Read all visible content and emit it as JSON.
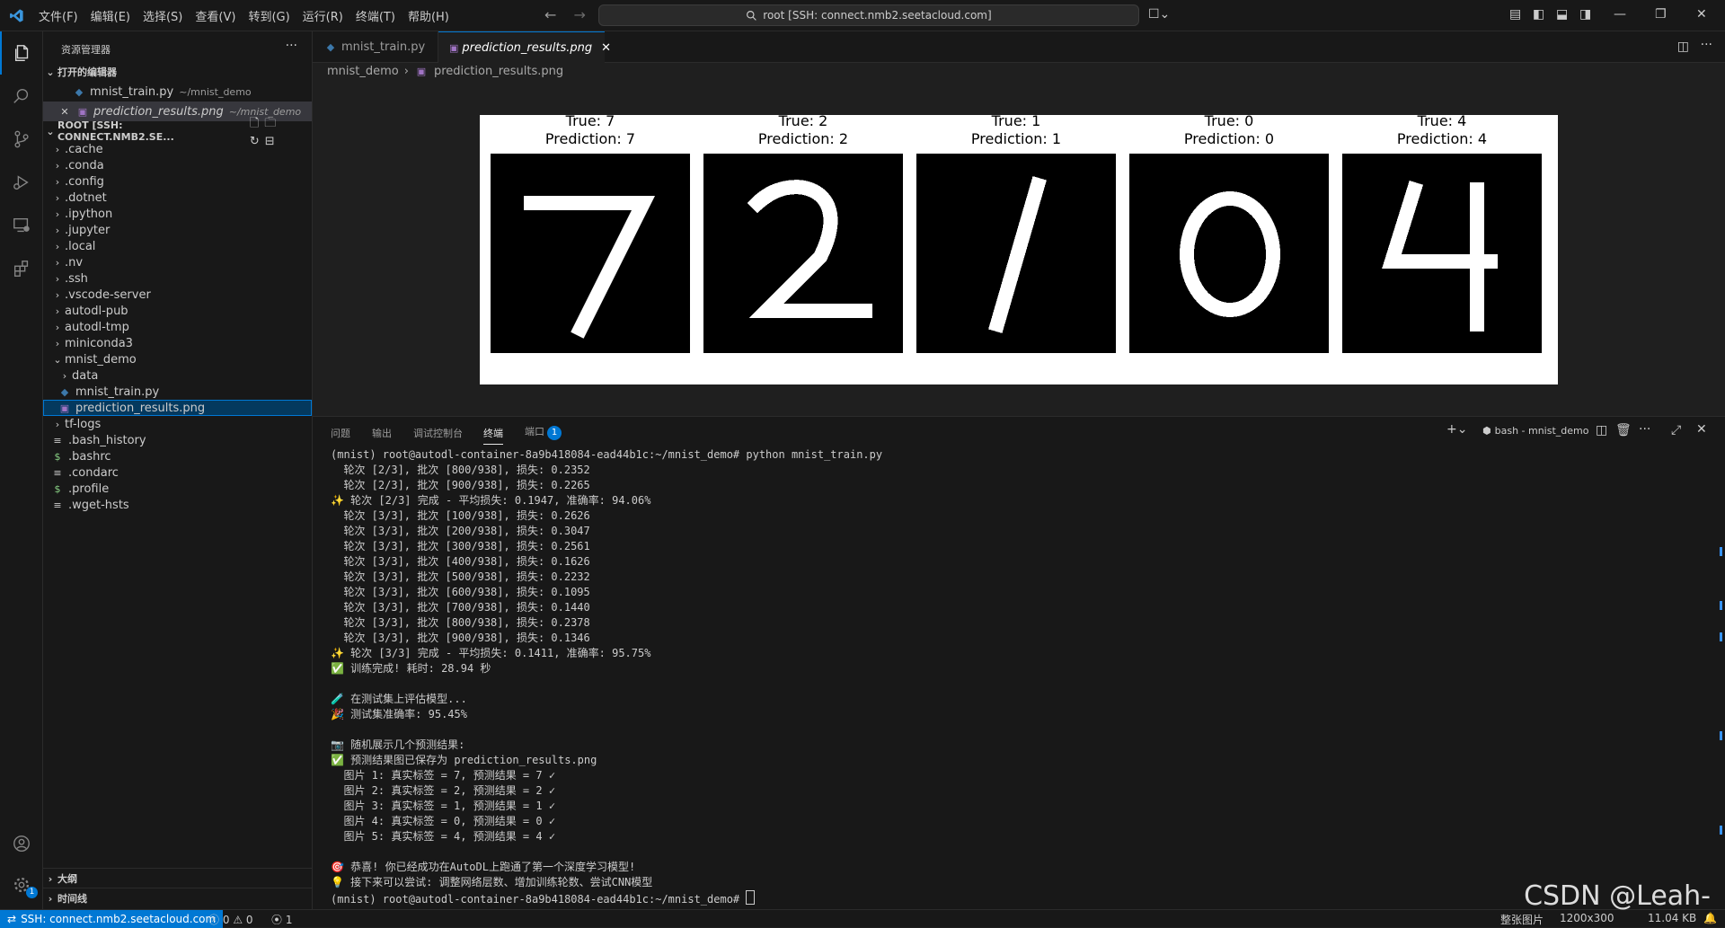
{
  "titlebar": {
    "menu": [
      "文件(F)",
      "编辑(E)",
      "选择(S)",
      "查看(V)",
      "转到(G)",
      "运行(R)",
      "终端(T)",
      "帮助(H)"
    ],
    "search_text": "root [SSH: connect.nmb2.seetacloud.com]"
  },
  "sidebar": {
    "title": "资源管理器",
    "open_editors_label": "打开的编辑器",
    "open_editors": [
      {
        "name": "mnist_train.py",
        "path": "~/mnist_demo"
      },
      {
        "name": "prediction_results.png",
        "path": "~/mnist_demo"
      }
    ],
    "root_label": "ROOT [SSH: CONNECT.NMB2.SE...",
    "tree": [
      {
        "label": ".cache",
        "type": "folder"
      },
      {
        "label": ".conda",
        "type": "folder"
      },
      {
        "label": ".config",
        "type": "folder"
      },
      {
        "label": ".dotnet",
        "type": "folder"
      },
      {
        "label": ".ipython",
        "type": "folder"
      },
      {
        "label": ".jupyter",
        "type": "folder"
      },
      {
        "label": ".local",
        "type": "folder"
      },
      {
        "label": ".nv",
        "type": "folder"
      },
      {
        "label": ".ssh",
        "type": "folder"
      },
      {
        "label": ".vscode-server",
        "type": "folder"
      },
      {
        "label": "autodl-pub",
        "type": "folder"
      },
      {
        "label": "autodl-tmp",
        "type": "folder"
      },
      {
        "label": "miniconda3",
        "type": "folder"
      },
      {
        "label": "mnist_demo",
        "type": "folder-open"
      },
      {
        "label": "data",
        "type": "folder"
      },
      {
        "label": "mnist_train.py",
        "type": "py"
      },
      {
        "label": "prediction_results.png",
        "type": "png"
      },
      {
        "label": "tf-logs",
        "type": "folder"
      },
      {
        "label": ".bash_history",
        "type": "file"
      },
      {
        "label": ".bashrc",
        "type": "shell"
      },
      {
        "label": ".condarc",
        "type": "file"
      },
      {
        "label": ".profile",
        "type": "shell"
      },
      {
        "label": ".wget-hsts",
        "type": "file"
      }
    ],
    "outline_label": "大纲",
    "timeline_label": "时间线"
  },
  "editor": {
    "tabs": [
      {
        "label": "mnist_train.py"
      },
      {
        "label": "prediction_results.png"
      }
    ],
    "breadcrumb": [
      "mnist_demo",
      "prediction_results.png"
    ],
    "image": {
      "panels": [
        {
          "true_label": "True: 7",
          "prediction": "Prediction: 7",
          "digit": "7"
        },
        {
          "true_label": "True: 2",
          "prediction": "Prediction: 2",
          "digit": "2"
        },
        {
          "true_label": "True: 1",
          "prediction": "Prediction: 1",
          "digit": "1"
        },
        {
          "true_label": "True: 0",
          "prediction": "Prediction: 0",
          "digit": "0"
        },
        {
          "true_label": "True: 4",
          "prediction": "Prediction: 4",
          "digit": "4"
        }
      ]
    }
  },
  "panel": {
    "tabs": [
      "问题",
      "输出",
      "调试控制台",
      "终端",
      "端口"
    ],
    "ports_badge": "1",
    "terminal_name": "bash - mnist_demo",
    "lines": [
      "(mnist) root@autodl-container-8a9b418084-ead44b1c:~/mnist_demo# python mnist_train.py",
      "  轮次 [2/3], 批次 [800/938], 损失: 0.2352",
      "  轮次 [2/3], 批次 [900/938], 损失: 0.2265",
      "✨ 轮次 [2/3] 完成 - 平均损失: 0.1947, 准确率: 94.06%",
      "  轮次 [3/3], 批次 [100/938], 损失: 0.2626",
      "  轮次 [3/3], 批次 [200/938], 损失: 0.3047",
      "  轮次 [3/3], 批次 [300/938], 损失: 0.2561",
      "  轮次 [3/3], 批次 [400/938], 损失: 0.1626",
      "  轮次 [3/3], 批次 [500/938], 损失: 0.2232",
      "  轮次 [3/3], 批次 [600/938], 损失: 0.1095",
      "  轮次 [3/3], 批次 [700/938], 损失: 0.1440",
      "  轮次 [3/3], 批次 [800/938], 损失: 0.2378",
      "  轮次 [3/3], 批次 [900/938], 损失: 0.1346",
      "✨ 轮次 [3/3] 完成 - 平均损失: 0.1411, 准确率: 95.75%",
      "✅ 训练完成! 耗时: 28.94 秒",
      "",
      "🧪 在测试集上评估模型...",
      "🎉 测试集准确率: 95.45%",
      "",
      "📷 随机展示几个预测结果:",
      "✅ 预测结果图已保存为 prediction_results.png",
      "  图片 1: 真实标签 = 7, 预测结果 = 7 ✓",
      "  图片 2: 真实标签 = 2, 预测结果 = 2 ✓",
      "  图片 3: 真实标签 = 1, 预测结果 = 1 ✓",
      "  图片 4: 真实标签 = 0, 预测结果 = 0 ✓",
      "  图片 5: 真实标签 = 4, 预测结果 = 4 ✓",
      "",
      "🎯 恭喜! 你已经成功在AutoDL上跑通了第一个深度学习模型!",
      "💡 接下来可以尝试: 调整网络层数、增加训练轮数、尝试CNN模型"
    ],
    "prompt": "(mnist) root@autodl-container-8a9b418084-ead44b1c:~/mnist_demo# "
  },
  "statusbar": {
    "remote": "SSH: connect.nmb2.seetacloud.com",
    "errors": "0",
    "warnings": "0",
    "ports": "1",
    "image_mode": "整张图片",
    "image_size": "1200x300",
    "file_size": "11.04 KB"
  },
  "watermark": "CSDN @Leah-",
  "colors": {
    "accent": "#0078d4",
    "selection": "#04395e",
    "python": "#3c78aa",
    "png": "#a074c4",
    "shell": "#89d185"
  }
}
